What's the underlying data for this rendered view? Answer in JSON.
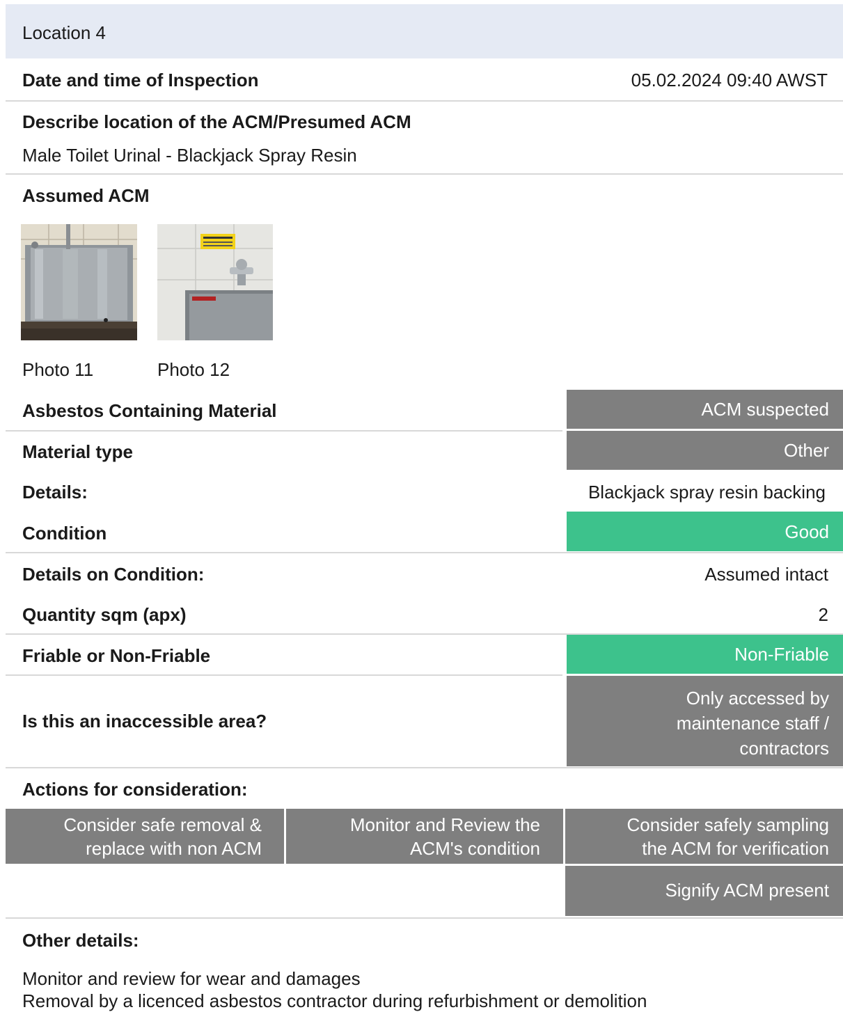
{
  "header": {
    "title": "Location 4"
  },
  "inspection": {
    "label": "Date and time of Inspection",
    "value": "05.02.2024 09:40 AWST"
  },
  "location": {
    "label": "Describe location of the ACM/Presumed ACM",
    "value": "Male Toilet Urinal - Blackjack Spray Resin"
  },
  "assumed": {
    "label": "Assumed ACM"
  },
  "photos": [
    {
      "caption": "Photo 11"
    },
    {
      "caption": "Photo 12"
    }
  ],
  "acm": {
    "label": "Asbestos Containing Material",
    "value": "ACM suspected"
  },
  "material": {
    "label": "Material type",
    "value": "Other"
  },
  "details": {
    "label": "Details:",
    "value": "Blackjack spray resin backing"
  },
  "condition": {
    "label": "Condition",
    "value": "Good"
  },
  "condition_details": {
    "label": "Details on Condition:",
    "value": "Assumed intact"
  },
  "quantity": {
    "label": "Quantity sqm (apx)",
    "value": "2"
  },
  "friable": {
    "label": "Friable or Non-Friable",
    "value": "Non-Friable"
  },
  "inaccessible": {
    "label": "Is this an inaccessible area?",
    "value_lines": [
      "Only accessed by",
      "maintenance staff /",
      "contractors"
    ]
  },
  "actions": {
    "label": "Actions for consideration:",
    "items": [
      {
        "lines": [
          "Consider safe removal &",
          "replace with non ACM"
        ]
      },
      {
        "lines": [
          "Monitor and Review the",
          "ACM's condition"
        ]
      },
      {
        "lines": [
          "Consider safely sampling",
          "the ACM for verification"
        ]
      },
      {
        "lines": [
          "Signify ACM present"
        ]
      }
    ]
  },
  "other": {
    "label": "Other details:",
    "lines": [
      "Monitor and review for wear and damages",
      "Removal by a licenced asbestos contractor during refurbishment or demolition"
    ]
  },
  "colors": {
    "header_bg": "#e5eaf4",
    "gray_box": "#7f7f7f",
    "green_box": "#3dc28c"
  }
}
